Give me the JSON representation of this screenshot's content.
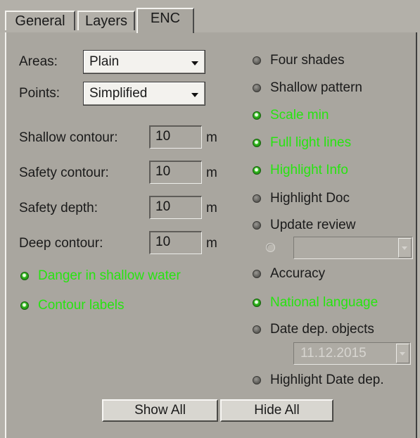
{
  "tabs": {
    "general": "General",
    "layers": "Layers",
    "enc": "ENC"
  },
  "settings": {
    "areas_label": "Areas:",
    "areas_value": "Plain",
    "points_label": "Points:",
    "points_value": "Simplified"
  },
  "contours": [
    {
      "label": "Shallow contour:",
      "value": "10",
      "unit": "m"
    },
    {
      "label": "Safety contour:",
      "value": "10",
      "unit": "m"
    },
    {
      "label": "Safety depth:",
      "value": "10",
      "unit": "m"
    },
    {
      "label": "Deep contour:",
      "value": "10",
      "unit": "m"
    }
  ],
  "left_options": [
    {
      "label": "Danger in shallow water",
      "checked": true
    },
    {
      "label": "Contour labels",
      "checked": true
    }
  ],
  "right_options": [
    {
      "label": "Four shades",
      "checked": false
    },
    {
      "label": "Shallow pattern",
      "checked": false
    },
    {
      "label": "Scale min",
      "checked": true
    },
    {
      "label": "Full light lines",
      "checked": true
    },
    {
      "label": "Highlight Info",
      "checked": true
    },
    {
      "label": "Highlight Doc",
      "checked": false
    },
    {
      "label": "Update review",
      "checked": false
    },
    {
      "label": "Accuracy",
      "checked": false
    },
    {
      "label": "National language",
      "checked": true
    },
    {
      "label": "Date dep. objects",
      "checked": false
    },
    {
      "label": "Highlight Date dep.",
      "checked": false
    }
  ],
  "update_review_select": "",
  "date_dep_value": "11.12.2015",
  "buttons": {
    "show_all": "Show All",
    "hide_all": "Hide All"
  },
  "colors": {
    "on_text": "#27e410",
    "panel_bg": "#a9a69f"
  }
}
